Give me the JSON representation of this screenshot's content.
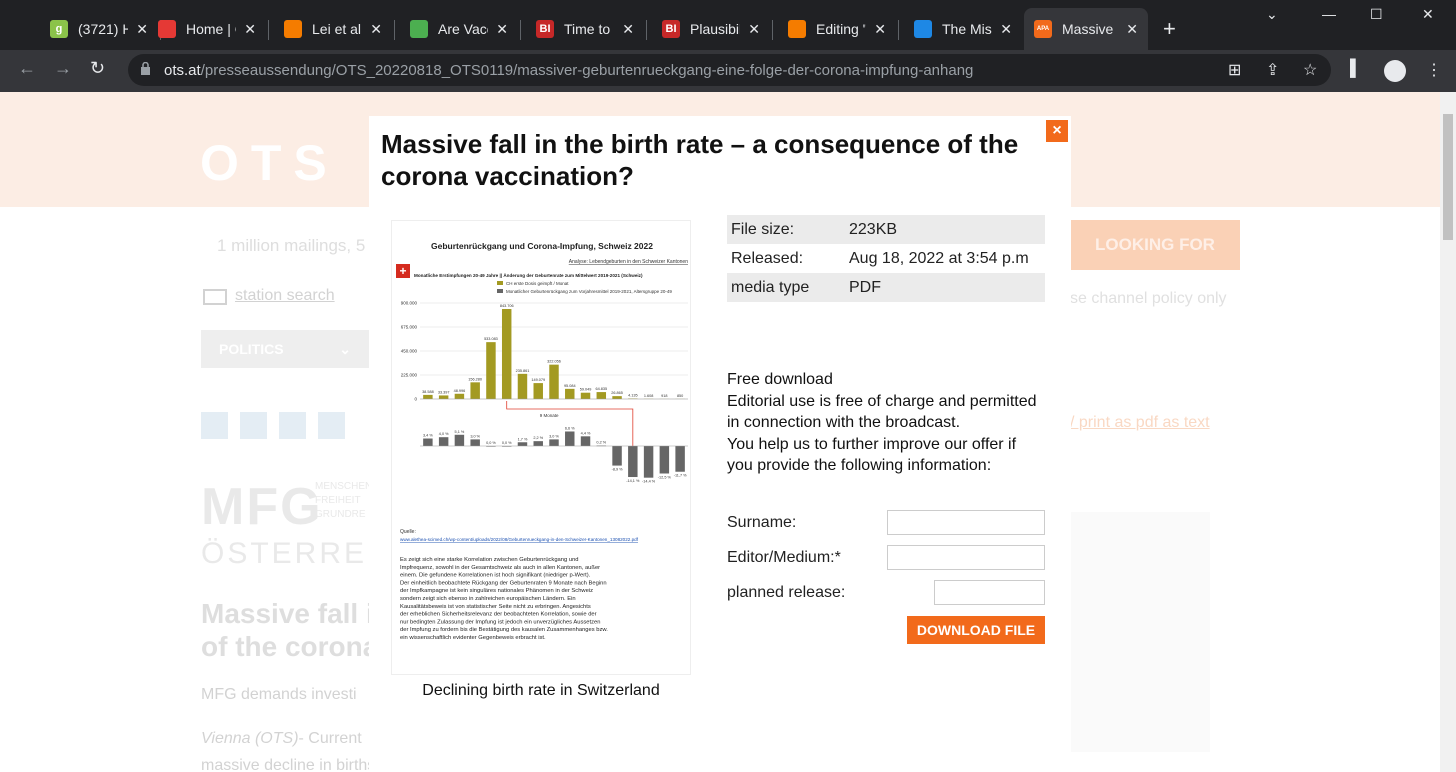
{
  "tabs": [
    {
      "title": "(3721) H",
      "icon": "g",
      "icon_color": "#8bc34a"
    },
    {
      "title": "Home | C",
      "icon": "home-dark",
      "icon_color": "#e53935"
    },
    {
      "title": "Lei et al.",
      "icon": "bookmark-orange",
      "icon_color": "#f57c00"
    },
    {
      "title": "Are Vacc",
      "icon": "globe",
      "icon_color": "#4caf50"
    },
    {
      "title": "Time to t",
      "icon": "BI",
      "icon_color": "#c62828"
    },
    {
      "title": "Plausibili",
      "icon": "BI",
      "icon_color": "#c62828"
    },
    {
      "title": "Editing \"",
      "icon": "bookmark-orange",
      "icon_color": "#f57c00"
    },
    {
      "title": "The Miss",
      "icon": "blue-logo",
      "icon_color": "#1e88e5"
    },
    {
      "title": "Massive",
      "icon": "APA",
      "icon_color": "#f26a1b"
    }
  ],
  "address": {
    "domain": "ots.at",
    "path": "/presseaussendung/OTS_20220818_OTS0119/massiver-geburtenrueckgang-eine-folge-der-corona-impfung-anhang"
  },
  "background": {
    "logo": "OTS",
    "search_text": "1 million mailings, 5",
    "looking_for": "LOOKING FOR",
    "station_search": "station search",
    "policy_text": "se channel policy only",
    "politics": "POLITICS",
    "print_links": "/  print as pdf  as text",
    "mfg": "MFG",
    "mfg_sub": "MENSCHEN FREIHEIT GRUNDRE",
    "osterreich": "ÖSTERREIC",
    "headline": "Massive fall i\nof the corona",
    "demands": "MFG demands investi",
    "vienna": "Vienna (OTS)",
    "vienna_rest": "- Current",
    "body_line": "massive decline in births in the first five months of this year. In Germany the"
  },
  "modal": {
    "title": "Massive fall in the birth rate – a consequence of the corona vaccination?",
    "close": "×",
    "caption": "Declining birth rate in Switzerland",
    "meta": [
      {
        "label": "File size:",
        "value": "223KB"
      },
      {
        "label": "Released:",
        "value": "Aug 18, 2022 at 3:54 p.m"
      },
      {
        "label": "media type",
        "value": "PDF"
      }
    ],
    "free_head": "Free download",
    "free_body": "Editorial use is free of charge and permitted in connection with the broadcast.",
    "help_text": "You help us to further improve our offer if you provide the following information:",
    "form": {
      "surname": "Surname:",
      "editor": "Editor/Medium:*",
      "planned": "planned release:"
    },
    "download": "DOWNLOAD FILE"
  },
  "thumbnail": {
    "title": "Geburtenrückgang und Corona-Impfung, Schweiz 2022",
    "analyse": "Analyse: Lebendgeburten in den Schweizer Kantonen",
    "subtitle": "Monatliche Erstimpfungen 20-49 Jahre || Änderung der Geburtenrate zum Mittelwert 2019-2021 (Schweiz)",
    "legend1": "CH erste Dosis geimpft / Monat",
    "legend2": "Monatlicher Geburtenrückgang zum Vorjahresmittel 2019-2021, Altersgruppe 20-49",
    "yticks": [
      "900.000",
      "675.000",
      "450.000",
      "225.000",
      "0"
    ],
    "bar_labels": [
      "38.588",
      "33.397",
      "48.996",
      "156.280",
      "533.083",
      "843.706",
      "235.861",
      "149.079",
      "322.056",
      "95.084",
      "59.049",
      "64.835",
      "26.865",
      "4.135",
      "1.608",
      "918",
      "850"
    ],
    "bar_values": [
      38588,
      33397,
      48996,
      156280,
      533083,
      843706,
      235861,
      149079,
      322056,
      95084,
      59049,
      64835,
      26865,
      4135,
      1608,
      918,
      850
    ],
    "months_label": "9 Monate",
    "pct_labels": [
      "3,4 %",
      "4,0 %",
      "5,1 %",
      "3,0 %",
      "0,0 %",
      "0,0 %",
      "1,7 %",
      "2,2 %",
      "3,0 %",
      "6,6 %",
      "4,4 %",
      "0,2 %",
      "-8,9 %",
      "-14,1 %",
      "-14,4 %",
      "-12,5 %",
      "-11,7 %"
    ],
    "pct_values": [
      3.4,
      4.0,
      5.1,
      3.0,
      0.0,
      0.0,
      1.7,
      2.2,
      3.0,
      6.6,
      4.4,
      0.2,
      -8.9,
      -14.1,
      -14.4,
      -12.5,
      -11.7
    ],
    "quelle": "Quelle:",
    "link": "www.alethea-scimed.ch/wp-content/uploads/2022/08/Geburtenrueckgang-in-den-Schweizer-Kantonen_13082022.pdf",
    "text": "Es zeigt sich eine starke Korrelation zwischen Geburtenrückgang und Impfrequenz, sowohl in der Gesamtschweiz als auch in allen Kantonen, außer einem. Die gefundene Korrelationen ist hoch signifikant (niedriger p-Wert). Der einheitlich beobachtete Rückgang der Geburtenraten 9 Monate nach Beginn der Impfkampagne ist kein singuläres nationales Phänomen in der Schweiz sondern zeigt sich ebenso in zahlreichen europäischen Ländern. Ein Kausalitätsbeweis ist von statistischer Seite nicht zu erbringen. Angesichts der erheblichen Sicherheitsrelevanz der beobachteten Korrelation, sowie der nur bedingten Zulassung der Impfung ist jedoch ein unverzügliches Aussetzen der Impfung zu fordern bis die Bestätigung des kausalen Zusammenhanges bzw. ein wissenschaftlich evidenter Gegenbeweis erbracht ist."
  }
}
